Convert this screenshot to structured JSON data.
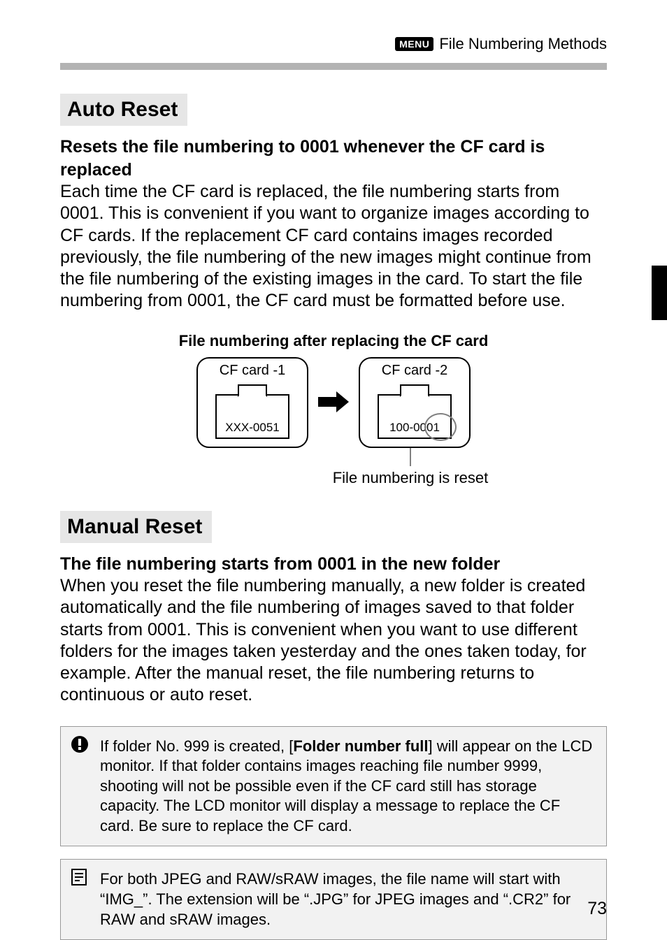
{
  "header": {
    "menu_badge": "MENU",
    "title": "File Numbering Methods"
  },
  "section1": {
    "title": "Auto Reset",
    "lead": "Resets the file numbering to 0001 whenever the CF card is replaced",
    "body": "Each time the CF card is replaced, the file numbering starts from 0001. This is convenient if you want to organize images according to CF cards. If the replacement CF card contains images recorded previously, the file numbering of the new images might continue from the file numbering of the existing images in the card. To start the file numbering from 0001, the CF card must be formatted before use."
  },
  "diagram": {
    "title": "File numbering after replacing the CF card",
    "card1_label": "CF card -1",
    "card1_folder": "XXX-0051",
    "card2_label": "CF card -2",
    "card2_folder": "100-0001",
    "caption": "File numbering is reset"
  },
  "section2": {
    "title": "Manual Reset",
    "lead": "The file numbering starts from 0001 in the new folder",
    "body": "When you reset the file numbering manually, a new folder is created automatically and the file numbering of images saved to that folder starts from 0001. This is convenient when you want to use different folders for the images taken yesterday and the ones taken today, for example. After the manual reset, the file numbering returns to continuous or auto reset."
  },
  "note1": {
    "pre": "If folder No. 999 is created, [",
    "bold": "Folder number full",
    "post": "] will appear on the LCD monitor. If that folder contains images reaching file number 9999, shooting will not be possible even if the CF card still has storage capacity. The LCD monitor will display a message to replace the CF card. Be sure to replace the CF card."
  },
  "note2": {
    "text": "For both JPEG and RAW/sRAW images, the file name will start with “IMG_”. The extension will be “.JPG” for JPEG images and “.CR2” for RAW and sRAW images."
  },
  "page_number": "73"
}
